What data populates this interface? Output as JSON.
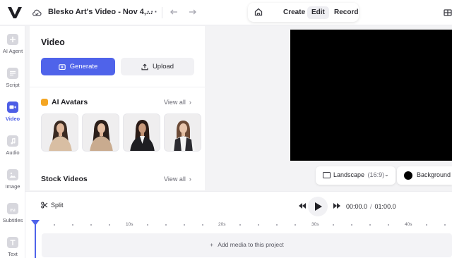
{
  "topbar": {
    "project_title": "Blesko Art's Video - Nov 4,...",
    "more_label": "···",
    "modes": {
      "create": "Create",
      "edit": "Edit",
      "record": "Record"
    }
  },
  "rail": {
    "items": [
      {
        "label": "AI Agent",
        "icon": "plus-square-icon",
        "active": false
      },
      {
        "label": "Script",
        "icon": "script-icon",
        "active": false
      },
      {
        "label": "Video",
        "icon": "video-camera-icon",
        "active": true
      },
      {
        "label": "Audio",
        "icon": "music-note-icon",
        "active": false
      },
      {
        "label": "Image",
        "icon": "image-icon",
        "active": false
      },
      {
        "label": "Subtitles",
        "icon": "subtitles-icon",
        "active": false
      },
      {
        "label": "Text",
        "icon": "text-icon",
        "active": false
      }
    ]
  },
  "panel": {
    "title": "Video",
    "generate_label": "Generate",
    "upload_label": "Upload",
    "ai_avatars": {
      "title": "AI Avatars",
      "view_all": "View all"
    },
    "stock_videos": {
      "title": "Stock Videos",
      "view_all": "View all"
    }
  },
  "canvas": {
    "aspect_label": "Landscape",
    "aspect_ratio": "(16:9)",
    "background_label": "Background",
    "background_color": "#000000"
  },
  "timeline": {
    "split_label": "Split",
    "current_time": "00:00.0",
    "separator": "/",
    "total_time": "01:00.0",
    "ruler_labels": [
      "10s",
      "20s",
      "30s",
      "40s"
    ],
    "empty_track_label": "Add media to this project"
  },
  "colors": {
    "accent": "#4f63ea"
  }
}
